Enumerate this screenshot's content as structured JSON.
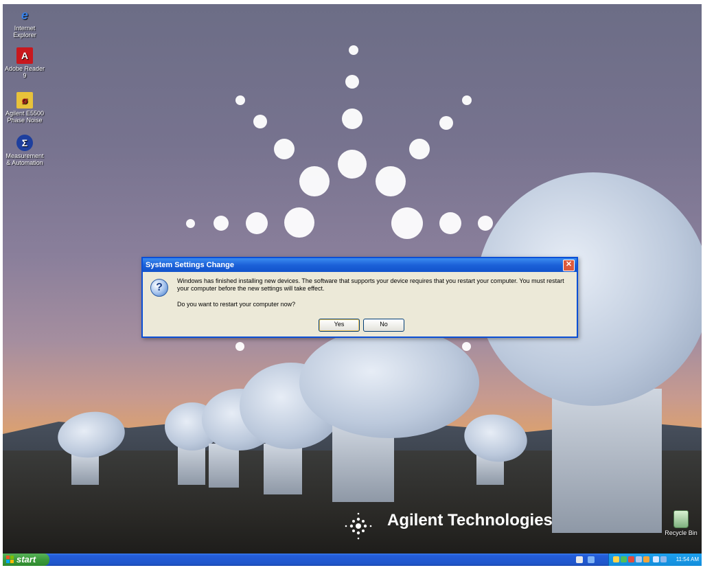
{
  "desktop": {
    "icons": [
      {
        "label": "Internet Explorer",
        "icon": "internet-explorer-icon"
      },
      {
        "label": "Adobe Reader 9",
        "icon": "adobe-reader-icon"
      },
      {
        "label": "Agilent E5500 Phase Noise",
        "icon": "phase-noise-icon"
      },
      {
        "label": "Measurement & Automation",
        "icon": "measurement-automation-icon"
      }
    ],
    "recycle_bin": "Recycle Bin",
    "brand": "Agilent Technologies"
  },
  "dialog": {
    "title": "System Settings Change",
    "message": "Windows has finished installing new devices. The software that supports your device requires that you restart your computer. You must restart your computer before the new settings will take effect.",
    "question": "Do you want to restart your computer now?",
    "yes_label": "Yes",
    "no_label": "No",
    "close_label": "✕"
  },
  "taskbar": {
    "start_label": "start",
    "clock": "11:54 AM"
  },
  "colors": {
    "titlebar": "#1c61d8",
    "taskbar": "#245edb",
    "start_button": "#3c9a3c",
    "dialog_bg": "#ece9d8"
  }
}
